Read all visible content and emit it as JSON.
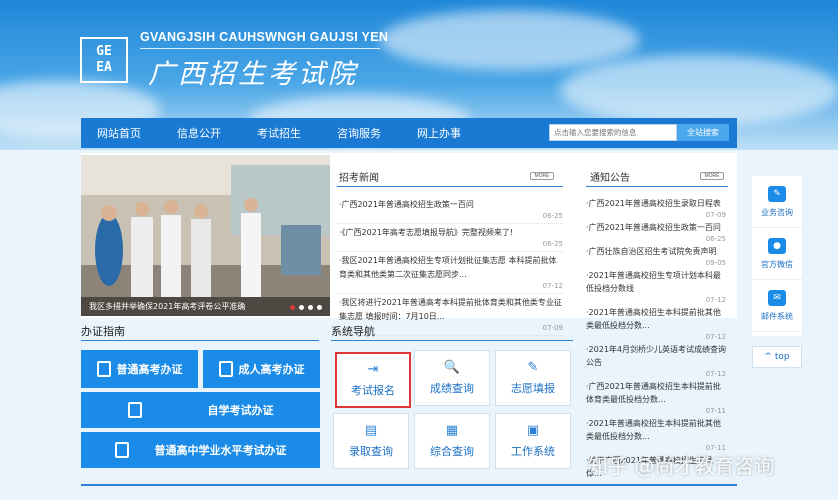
{
  "header": {
    "logo_letters": [
      "GE",
      "EA"
    ],
    "site_name_en": "GVANGJSIH CAUHSWNGH GAUJSI YEN",
    "site_name_cn": "广西招生考试院"
  },
  "nav": {
    "items": [
      "网站首页",
      "信息公开",
      "考试招生",
      "咨询服务",
      "网上办事"
    ],
    "search_placeholder": "点击输入您要搜索的信息",
    "search_button": "全站搜索"
  },
  "slider": {
    "caption": "我区多措并举确保2021年高考评卷公平准确"
  },
  "news": {
    "title": "招考新闻",
    "more": "MORE",
    "items": [
      {
        "text": "·广西2021年普通高校招生政策一百问",
        "date": "06-25"
      },
      {
        "text": "·《广西2021年高考志愿填报导航》完整视频来了!",
        "date": "06-25"
      },
      {
        "text": "·我区2021年普通高校招生专项计划批征集志愿 本科提前批体育类和其他类第二次征集志愿同步...",
        "date": "07-12"
      },
      {
        "text": "·我区将进行2021年普通高考本科提前批体育类和其他类专业征集志愿 填报时间：7月10日...",
        "date": "07-09"
      }
    ]
  },
  "notice": {
    "title": "通知公告",
    "more": "MORE",
    "items": [
      {
        "text": "·广西2021年普通高校招生录取日程表",
        "date": "07-09"
      },
      {
        "text": "·广西2021年普通高校招生政策一百问",
        "date": "06-25"
      },
      {
        "text": "·广西壮族自治区招生考试院免责声明",
        "date": "09-05"
      },
      {
        "text": "·2021年普通高校招生专项计划本科最低投档分数线",
        "date": "07-12"
      },
      {
        "text": "·2021年普通高校招生本科提前批其他类最低投档分数...",
        "date": "07-12"
      },
      {
        "text": "·2021年4月剑桥少儿英语考试成绩查询公告",
        "date": "07-12"
      },
      {
        "text": "·广西2021年普通高校招生本科提前批体育类最低投档分数...",
        "date": "07-11"
      },
      {
        "text": "·2021年普通高校招生本科提前批其他类最低投档分数...",
        "date": "07-11"
      },
      {
        "text": "·关于广西2021年普通高校招生不具体...",
        "date": ""
      }
    ]
  },
  "guide": {
    "title": "办证指南",
    "buttons": [
      "普通高考办证",
      "成人高考办证",
      "自学考试办证",
      "普通高中学业水平考试办证"
    ]
  },
  "sysnav": {
    "title": "系统导航",
    "buttons": [
      {
        "label": "考试报名",
        "icon": "login-icon",
        "glyph": "⇥"
      },
      {
        "label": "成绩查询",
        "icon": "search-icon",
        "glyph": "🔍"
      },
      {
        "label": "志愿填报",
        "icon": "pen-icon",
        "glyph": "✎"
      },
      {
        "label": "录取查询",
        "icon": "document-icon",
        "glyph": "▤"
      },
      {
        "label": "综合查询",
        "icon": "clipboard-icon",
        "glyph": "▦"
      },
      {
        "label": "工作系统",
        "icon": "grid-icon",
        "glyph": "▣"
      }
    ]
  },
  "side": {
    "items": [
      {
        "label": "业务咨询",
        "icon": "chat-icon",
        "glyph": "✎"
      },
      {
        "label": "官方微信",
        "icon": "wechat-icon",
        "glyph": "●"
      },
      {
        "label": "邮件系统",
        "icon": "mail-icon",
        "glyph": "✉"
      }
    ],
    "top": "^ top"
  },
  "watermark": "知乎 @尚才教育咨询",
  "colors": {
    "primary": "#1a8be6",
    "nav": "#1a7ad3",
    "highlight": "#e13535"
  }
}
